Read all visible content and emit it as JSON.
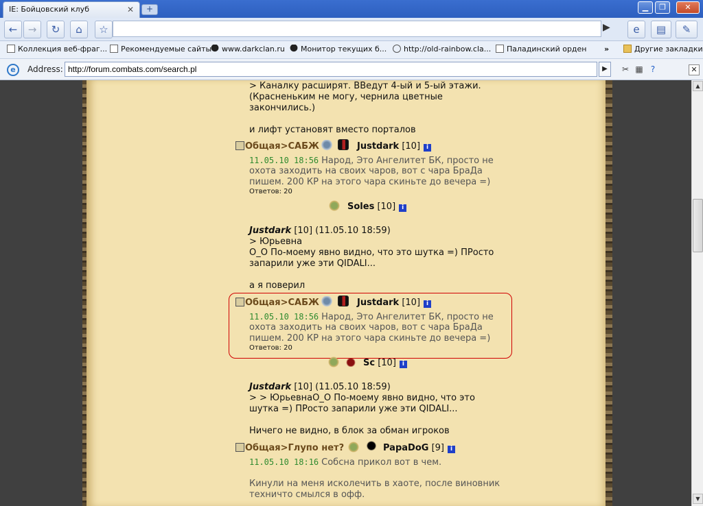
{
  "window": {
    "tab_title": "IE: Бойцовский клуб"
  },
  "bookmarks": [
    {
      "label": "Коллекция веб-фраг..."
    },
    {
      "label": "Рекомендуемые сайты"
    },
    {
      "label": "www.darkclan.ru"
    },
    {
      "label": "Монитор текущих б..."
    },
    {
      "label": "http://old-rainbow.cla..."
    },
    {
      "label": "Паладинский орден"
    }
  ],
  "other_bookmarks": "Другие закладки",
  "ie": {
    "address_label": "Address:",
    "url": "http://forum.combats.com/search.pl"
  },
  "posts": {
    "quote1": {
      "l1": "> Каналку расширят. ВВедут 4-ый и 5-ый этажи.",
      "l2": "(Красненьким не могу, чернила цветные",
      "l3": "закончились.)",
      "l4": "и лифт установят вместо порталов"
    },
    "thread1": {
      "category": "Общая>САБЖ",
      "user": "Justdark",
      "level": "[10]",
      "date": "11.05.10 18:56",
      "t1": "Народ, Это Ангелитет БК, просто не",
      "t2": "охота заходить на своих чаров, вот с чара БраДа",
      "t3": "пишем. 200 КР на этого чара скиньте до вечера =)",
      "answers": "Ответов: 20"
    },
    "reply_soles": {
      "user": "Soles",
      "level": "[10]"
    },
    "quote2": {
      "author": "Justdark",
      "meta": "[10] (11.05.10 18:59)",
      "l1": "> Юрьевна",
      "l2": "О_О По-моему явно видно, что это шутка =) ПРосто",
      "l3": "запарили уже эти QIDALI...",
      "l4": "а я поверил"
    },
    "thread2": {
      "category": "Общая>САБЖ",
      "user": "Justdark",
      "level": "[10]",
      "date": "11.05.10 18:56",
      "t1": "Народ, Это Ангелитет БК, просто не",
      "t2": "охота заходить на своих чаров, вот с чара БраДа",
      "t3": "пишем. 200 КР на этого чара скиньте до вечера =)",
      "answers": "Ответов: 20"
    },
    "reply_sc": {
      "user": "Sc",
      "level": "[10]"
    },
    "quote3": {
      "author": "Justdark",
      "meta": "[10] (11.05.10 18:59)",
      "l1": "> > ЮрьевнаО_О По-моему явно видно, что это",
      "l2": "шутка =) ПРосто запарили уже эти QIDALI...",
      "l3": "Ничего не видно, в блок за обман игроков"
    },
    "thread3": {
      "category": "Общая>Глупо нет?",
      "user": "PapaDoG",
      "level": "[9]",
      "date": "11.05.10 18:16",
      "t1": "Собсна прикол вот в чем.",
      "t2": "Кинули на меня исколечить в хаоте, после виновник",
      "t3": "техничто смылся в офф."
    }
  }
}
